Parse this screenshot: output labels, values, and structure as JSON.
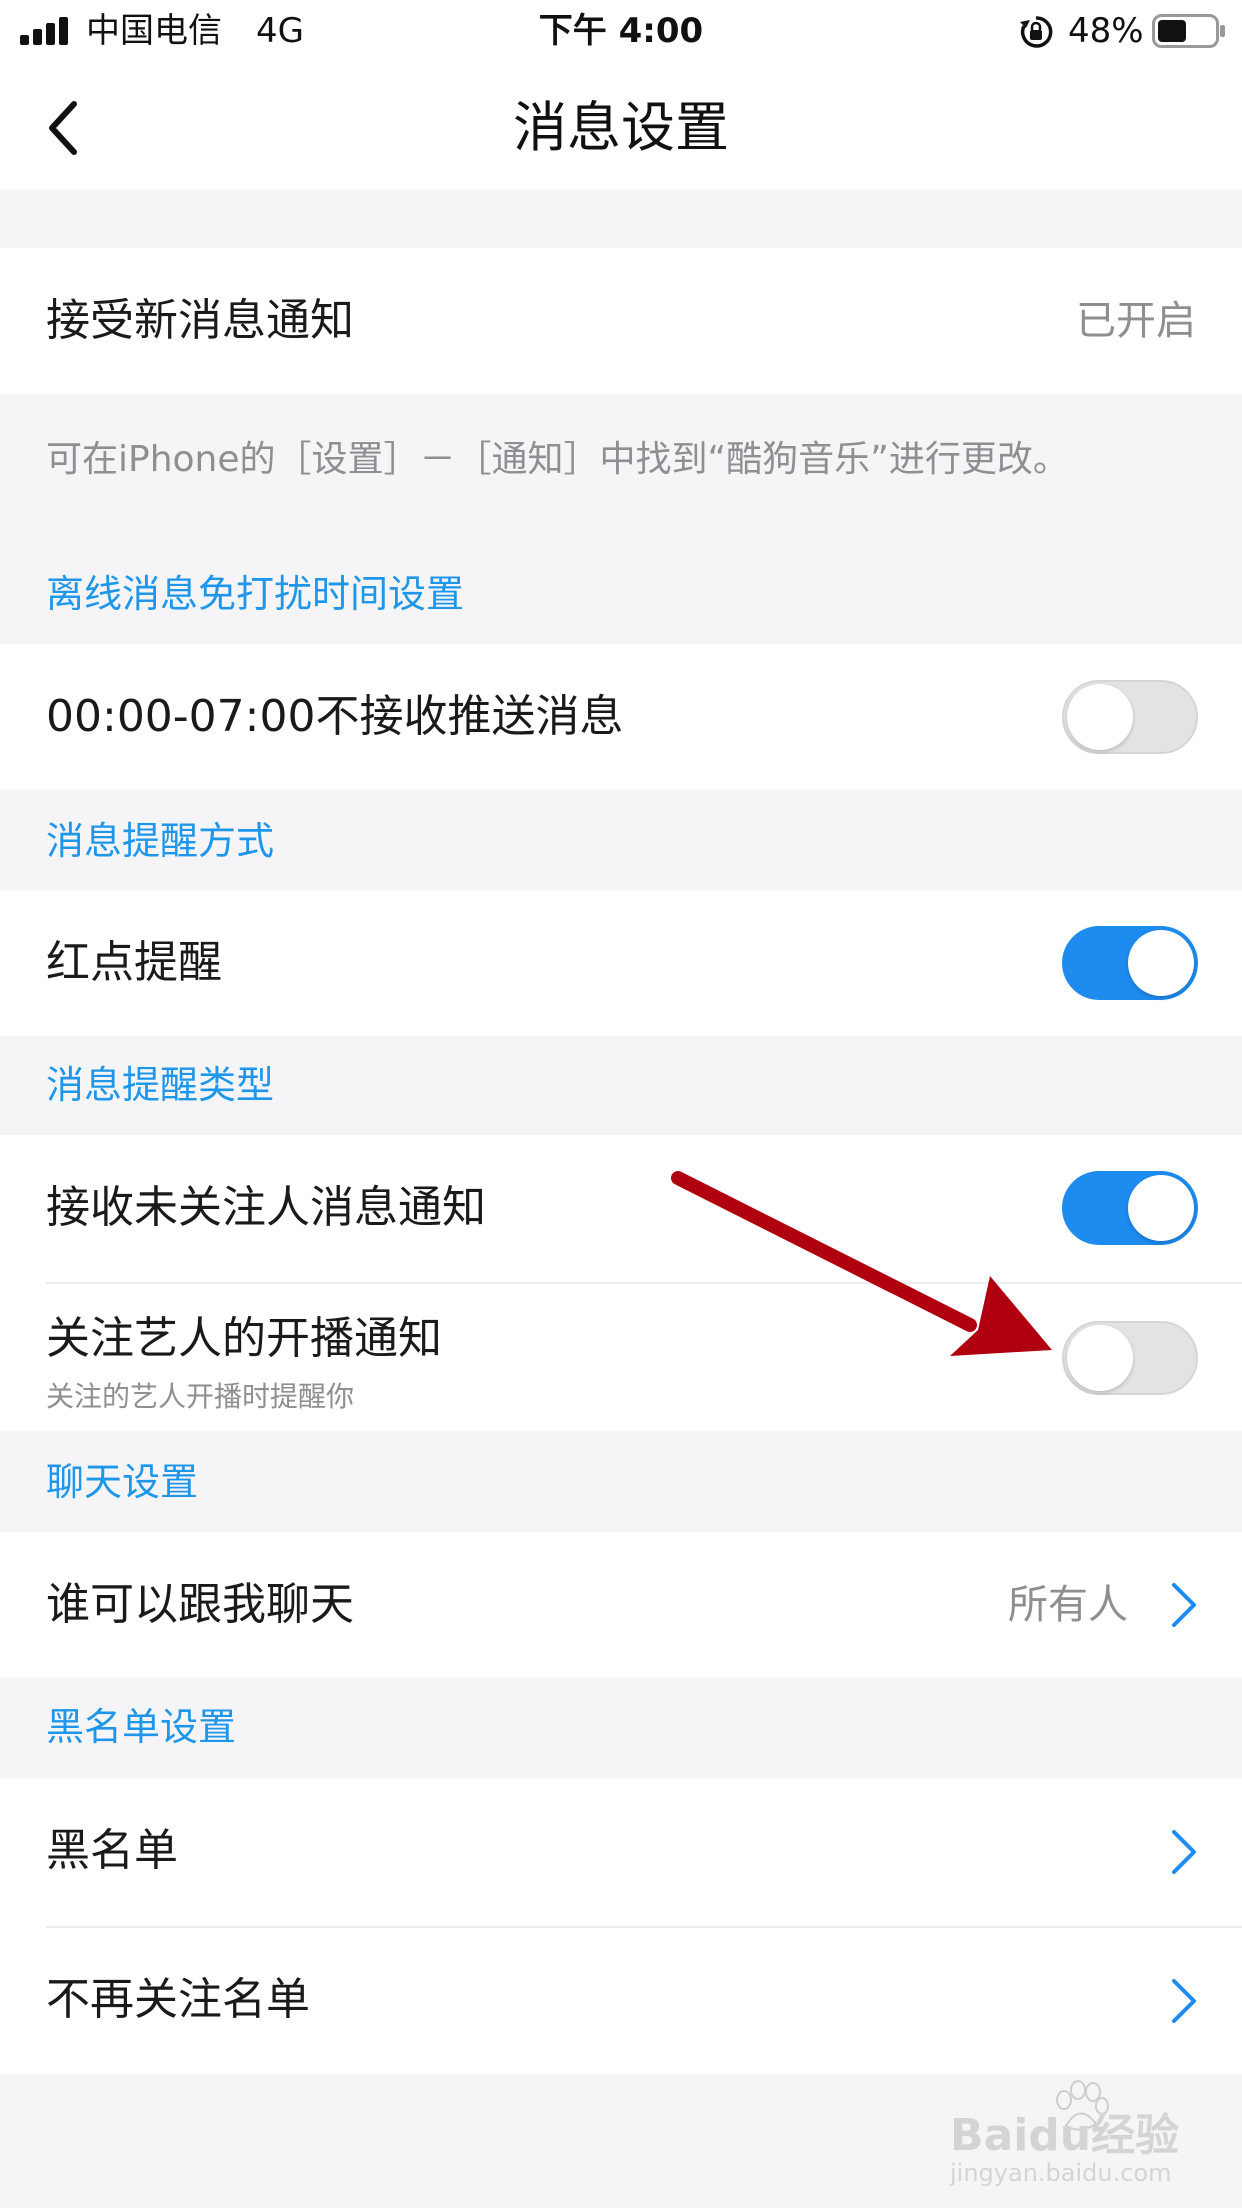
{
  "status_bar": {
    "carrier": "中国电信",
    "network": "4G",
    "time": "下午 4:00",
    "battery": "48%"
  },
  "header": {
    "title": "消息设置"
  },
  "notifications": {
    "label": "接受新消息通知",
    "value": "已开启",
    "note": "可在iPhone的［设置］－［通知］中找到“酷狗音乐”进行更改。"
  },
  "sections": {
    "dnd": {
      "title": "离线消息免打扰时间设置",
      "row_label": "00:00-07:00不接收推送消息",
      "toggle_on": false
    },
    "reminder_method": {
      "title": "消息提醒方式",
      "row_label": "红点提醒",
      "toggle_on": true
    },
    "reminder_type": {
      "title": "消息提醒类型",
      "rows": [
        {
          "label": "接收未关注人消息通知",
          "toggle_on": true
        },
        {
          "label": "关注艺人的开播通知",
          "sublabel": "关注的艺人开播时提醒你",
          "toggle_on": false
        }
      ]
    },
    "chat": {
      "title": "聊天设置",
      "row_label": "谁可以跟我聊天",
      "row_value": "所有人"
    },
    "blacklist": {
      "title": "黑名单设置",
      "rows": [
        {
          "label": "黑名单"
        },
        {
          "label": "不再关注名单"
        }
      ]
    }
  },
  "colors": {
    "accent": "#1e8bef",
    "section_title": "#1e96ea",
    "annotation_arrow": "#b00010"
  },
  "watermark": "Baidu经验 jingyan.baidu.com"
}
